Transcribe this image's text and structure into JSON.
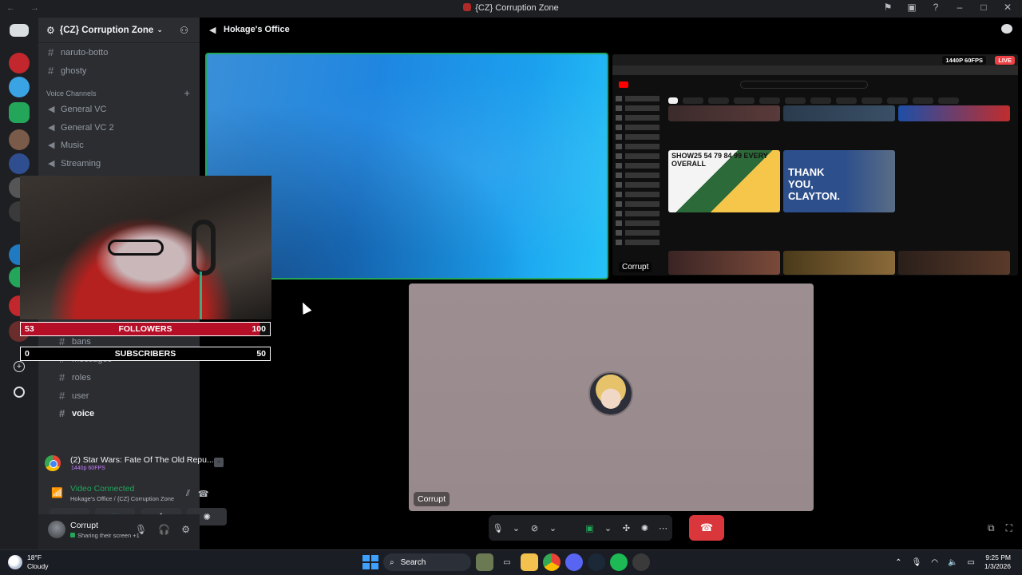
{
  "window": {
    "title": "{CZ} Corruption Zone",
    "nav": "← →"
  },
  "server": {
    "name": "{CZ} Corruption Zone",
    "chevron": "⌄"
  },
  "channels_top": [
    {
      "name": "naruto-botto"
    },
    {
      "name": "ghosty"
    }
  ],
  "voice_category": "Voice Channels",
  "voice_channels": [
    {
      "name": "General VC"
    },
    {
      "name": "General VC 2"
    },
    {
      "name": "Music"
    },
    {
      "name": "Streaming"
    }
  ],
  "lower_channels": [
    {
      "name": "bans"
    },
    {
      "name": "messages"
    },
    {
      "name": "roles"
    },
    {
      "name": "user"
    },
    {
      "name": "voice"
    }
  ],
  "activity": {
    "title": "(2) Star Wars: Fate Of The Old Repu...",
    "sub": "1440p 60FPS",
    "close": "×"
  },
  "voice_status": {
    "title": "Video Connected",
    "sub": "Hokage's Office / {CZ} Corruption Zone"
  },
  "user": {
    "name": "Corrupt",
    "status": "Sharing their screen +1"
  },
  "call": {
    "channel": "Hokage's Office"
  },
  "stream": {
    "resolution": "1440P 60FPS",
    "live": "LIVE",
    "label": "Corrupt"
  },
  "stream_thumbs": [
    {
      "text": "SHOW25 54 79 84 99 EVERY OVERALL"
    },
    {
      "text": "THANK YOU, CLAYTON."
    }
  ],
  "participant": {
    "name": "Corrupt"
  },
  "overlay": {
    "followers": {
      "current": "53",
      "label": "FOLLOWERS",
      "goal": "100",
      "progress": 0.53
    },
    "subscribers": {
      "current": "0",
      "label": "SUBSCRIBERS",
      "goal": "50",
      "progress": 0
    }
  },
  "taskbar": {
    "temp": "18°F",
    "weather": "Cloudy",
    "search": "Search",
    "time": "9:25 PM",
    "date": "1/3/2026"
  },
  "icons": {
    "titlebar": [
      "inbox-icon",
      "monitor-icon",
      "help-icon",
      "minimize-icon",
      "maximize-icon",
      "close-icon"
    ]
  }
}
